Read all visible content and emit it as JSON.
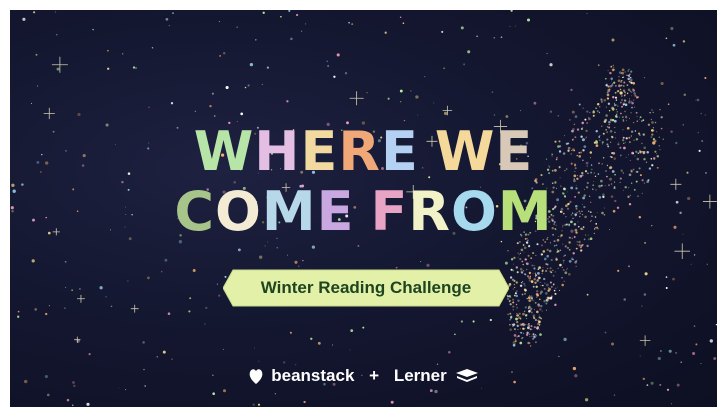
{
  "poster": {
    "title_line1": [
      "W",
      "H",
      "E",
      "R",
      "E",
      " ",
      "W",
      "E"
    ],
    "title_line2": [
      "C",
      "O",
      "M",
      "E",
      " ",
      "F",
      "R",
      "O",
      "M"
    ],
    "banner_text": "Winter Reading Challenge",
    "sponsor_1": "beanstack",
    "plus": "+",
    "sponsor_2": "Lerner"
  },
  "colors": {
    "title_line1": [
      "#b7e4a7",
      "#e4bfe3",
      "#f2d9a0",
      "#f0a878",
      "#b4d0f2",
      " ",
      "#f4d99a",
      "#d8c8b8"
    ],
    "title_line2": [
      "#a7c58a",
      "#f3ebd4",
      "#b7d8e8",
      "#c9a8e2",
      " ",
      "#e8a4c4",
      "#f1f2c8",
      "#a6d8ee",
      "#b8e07a"
    ],
    "banner": "#e3f0a8",
    "banner_text": "#1f4420",
    "background": "#141730"
  },
  "icons": {
    "sponsor_1_icon": "heart-leaf-icon",
    "sponsor_2_icon": "open-book-icon"
  }
}
